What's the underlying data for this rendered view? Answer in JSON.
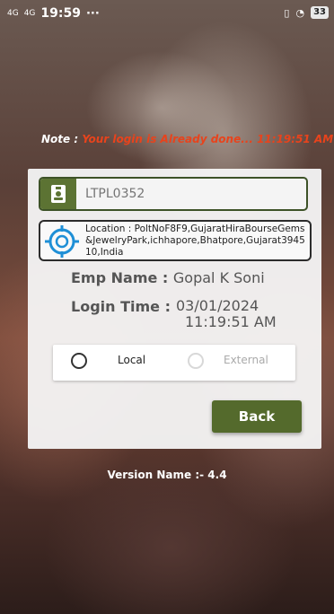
{
  "status_bar": {
    "signal_1": "4G",
    "signal_2": "4G",
    "time": "19:59",
    "more": "···",
    "battery": "33"
  },
  "note": {
    "label": "Note :",
    "message": " Your login is Already done... 11:19:51 AM",
    "message_color": "#e8431c"
  },
  "form": {
    "emp_code_placeholder": "LTPL0352",
    "location_text": "Location : PoltNoF8F9,GujaratHiraBourseGems&JewelryPark,ichhapore,Bhatpore,Gujarat394510,India",
    "emp_name_label": "Emp Name :",
    "emp_name_value": "Gopal K Soni",
    "login_time_label": "Login Time :",
    "login_date": "03/01/2024",
    "login_clock": "11:19:51 AM"
  },
  "options": {
    "local_label": "Local",
    "external_label": "External",
    "selected": "Local"
  },
  "back_label": "Back",
  "version_text": "Version Name :- 4.4",
  "colors": {
    "accent_green": "#546a2c",
    "icon_blue": "#1e8fd6"
  }
}
